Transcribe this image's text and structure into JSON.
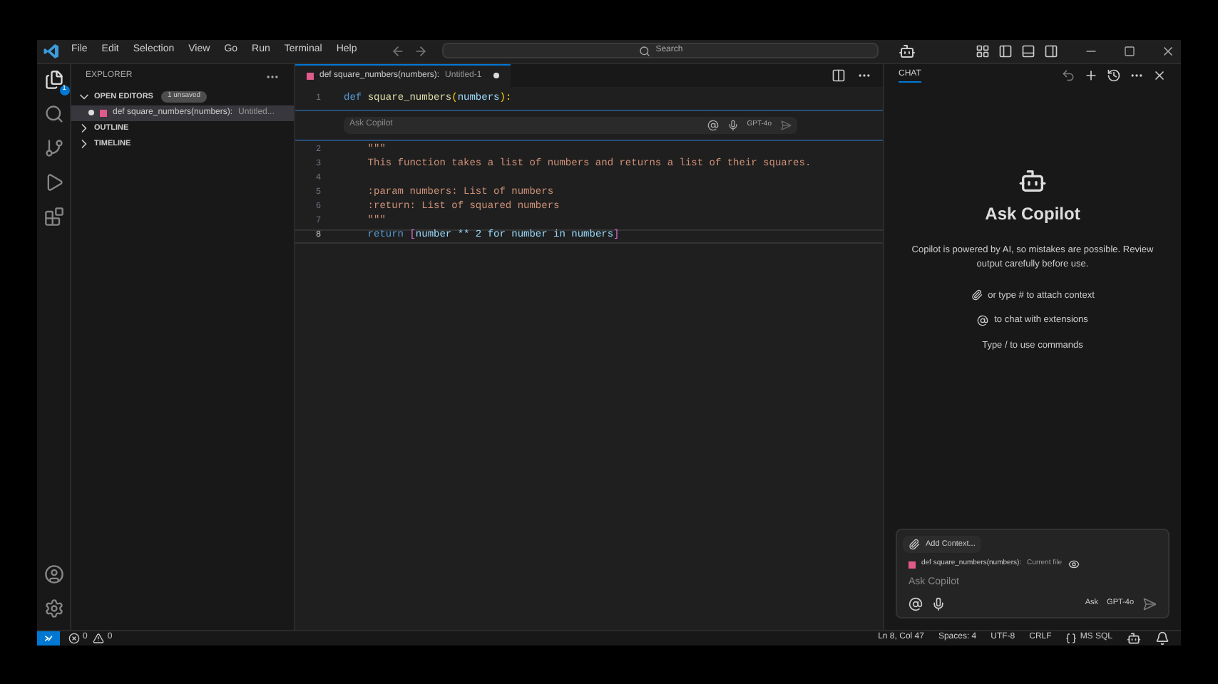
{
  "title_bar": {
    "menu": [
      "File",
      "Edit",
      "Selection",
      "View",
      "Go",
      "Run",
      "Terminal",
      "Help"
    ],
    "search": {
      "placeholder": "Search"
    }
  },
  "activity_bar": {
    "explorer_badge": "1"
  },
  "sidebar": {
    "title": "EXPLORER",
    "sections": [
      {
        "label": "OPEN EDITORS",
        "expanded": true,
        "badge": "1 unsaved",
        "items": [
          {
            "label": "def square_numbers(numbers):",
            "description": "Untitled...",
            "dirty": true
          }
        ]
      },
      {
        "label": "OUTLINE",
        "expanded": false
      },
      {
        "label": "TIMELINE",
        "expanded": false
      }
    ]
  },
  "editor": {
    "tab": {
      "label": "def square_numbers(numbers):",
      "description": "Untitled-1",
      "dirty": true
    },
    "inline_chat": {
      "placeholder": "Ask Copilot",
      "model": "GPT-4o"
    },
    "lines": [
      {
        "number": "1",
        "current": false,
        "tokens": [
          {
            "text": "def ",
            "kind": "keyword"
          },
          {
            "text": "square_numbers",
            "kind": "function"
          },
          {
            "text": "(",
            "kind": "paren"
          },
          {
            "text": "numbers",
            "kind": "param"
          },
          {
            "text": "):",
            "kind": "paren"
          }
        ]
      },
      {
        "number": "2",
        "current": false,
        "tokens": [
          {
            "text": "    \"\"\"",
            "kind": "string"
          }
        ]
      },
      {
        "number": "3",
        "current": false,
        "tokens": [
          {
            "text": "    This function takes a list of numbers and returns a list of their squares.",
            "kind": "string"
          }
        ]
      },
      {
        "number": "4",
        "current": false
      },
      {
        "number": "5",
        "current": false,
        "tokens": [
          {
            "text": "    :param numbers: List of numbers",
            "kind": "string"
          }
        ]
      },
      {
        "number": "6",
        "current": false,
        "tokens": [
          {
            "text": "    :return: List of squared numbers",
            "kind": "string"
          }
        ]
      },
      {
        "number": "7",
        "current": false,
        "tokens": [
          {
            "text": "    \"\"\"",
            "kind": "string"
          }
        ]
      },
      {
        "number": "8",
        "current": true,
        "tokens": [
          {
            "text": "    return ",
            "kind": "keyword"
          },
          {
            "text": "[",
            "kind": "bracket"
          },
          {
            "text": "number ** 2 for number in numbers",
            "kind": "param"
          },
          {
            "text": "]",
            "kind": "bracket"
          }
        ]
      }
    ]
  },
  "chat": {
    "header": "CHAT",
    "title": "Ask Copilot",
    "disclaimer": "Copilot is powered by AI, so mistakes are possible. Review output carefully before use.",
    "hints": [
      {
        "kind": "attach",
        "text": "or type # to attach context"
      },
      {
        "kind": "mention",
        "text": "to chat with extensions"
      },
      {
        "kind": "text",
        "text": "Type / to use commands"
      }
    ],
    "input": {
      "add_context": "Add Context...",
      "file": {
        "label": "def square_numbers(numbers):",
        "description": "Current file"
      },
      "placeholder": "Ask Copilot",
      "mode": "Ask",
      "model": "GPT-4o"
    }
  },
  "status_bar": {
    "errors": "0",
    "warnings": "0",
    "items": [
      "Ln 8, Col 47",
      "Spaces: 4",
      "UTF-8",
      "CRLF",
      "MS SQL"
    ]
  }
}
